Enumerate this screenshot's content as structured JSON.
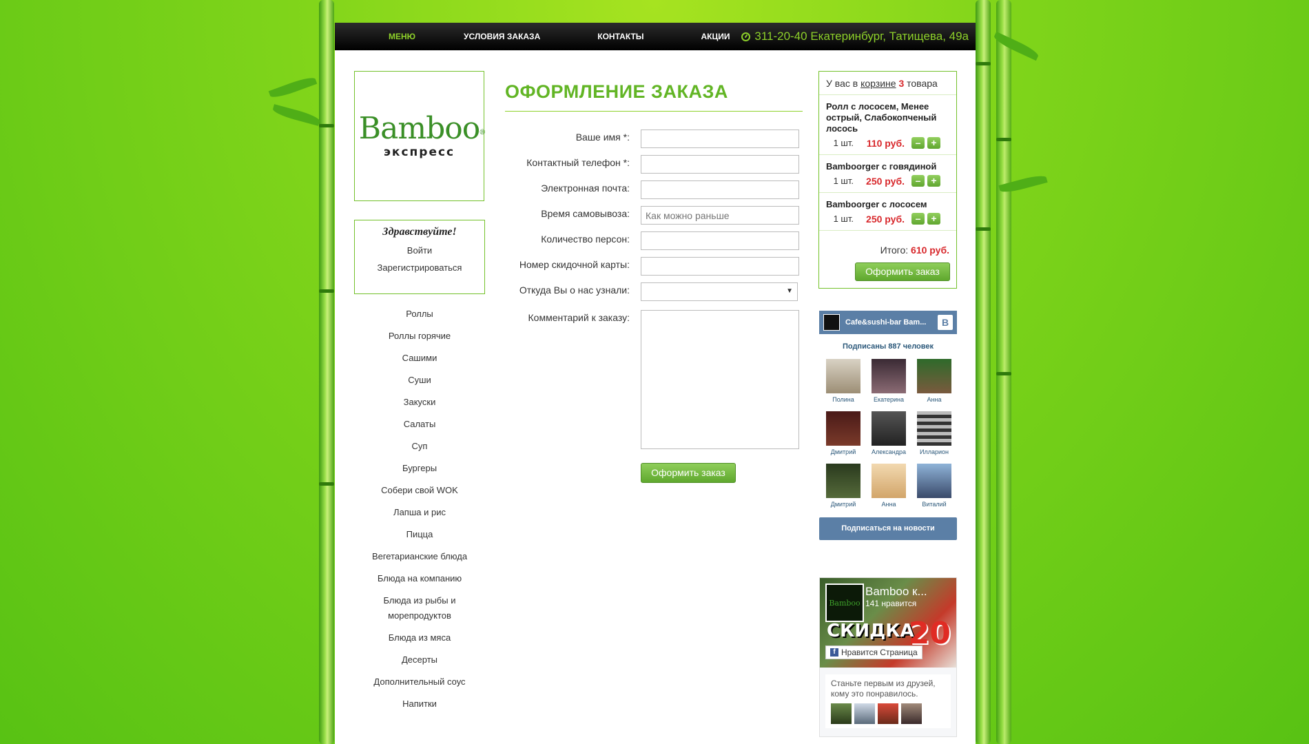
{
  "nav": {
    "items": [
      "МЕНЮ",
      "УСЛОВИЯ ЗАКАЗА",
      "КОНТАКТЫ",
      "АКЦИИ"
    ],
    "phone": "311-20-40 Екатеринбург, Татищева, 49а"
  },
  "logo": {
    "word": "Bamboo",
    "reg": "®",
    "sub": "экспресс"
  },
  "welcome": {
    "greeting": "Здравствуйте!",
    "login": "Войти",
    "register": "Зарегистрироваться"
  },
  "menu": [
    "Роллы",
    "Роллы горячие",
    "Сашими",
    "Суши",
    "Закуски",
    "Салаты",
    "Суп",
    "Бургеры",
    "Собери свой WOK",
    "Лапша и рис",
    "Пицца",
    "Вегетарианские блюда",
    "Блюда на компанию",
    "Блюда из рыбы и морепродуктов",
    "Блюда из мяса",
    "Десерты",
    "Дополнительный соус",
    "Напитки"
  ],
  "form": {
    "title": "ОФОРМЛЕНИЕ ЗАКАЗА",
    "labels": [
      "Ваше имя *:",
      "Контактный телефон *:",
      "Электронная почта:",
      "Время самовывоза:",
      "Количество персон:",
      "Номер скидочной карты:",
      "Откуда Вы о нас узнали:",
      "Комментарий к заказу:"
    ],
    "pickup_placeholder": "Как можно раньше",
    "submit": "Оформить заказ"
  },
  "cart": {
    "head_prefix": "У вас в ",
    "head_link": "корзине",
    "count": "3",
    "head_suffix": " товара",
    "items": [
      {
        "name": "Ролл с лососем, Менее острый, Слабокопченый лосось",
        "qty": "1 шт.",
        "price": "110 руб."
      },
      {
        "name": "Bamboorger с говядиной",
        "qty": "1 шт.",
        "price": "250 руб."
      },
      {
        "name": "Bamboorger с лососем",
        "qty": "1 шт.",
        "price": "250 руб."
      }
    ],
    "total_label": "Итого:",
    "total_value": "610 руб.",
    "checkout": "Оформить заказ",
    "minus": "–",
    "plus": "+"
  },
  "vk": {
    "title": "Cafe&sushi-bar Bam...",
    "logo": "В",
    "subscribers": "Подписаны 887 человек",
    "people": [
      "Полина",
      "Екатерина",
      "Анна",
      "Дмитрий",
      "Александра",
      "Илларион",
      "Дмитрий",
      "Анна",
      "Виталий"
    ],
    "subscribe": "Подписаться на новости"
  },
  "fb": {
    "name": "Bamboo к...",
    "likes": "141 нравится",
    "logo_text": "Bamboo",
    "promo": "СКИДКА",
    "promo_num": "20",
    "like_button": "Нравится Страница",
    "first_friends": "Станьте первым из друзей, кому это понравилось."
  }
}
